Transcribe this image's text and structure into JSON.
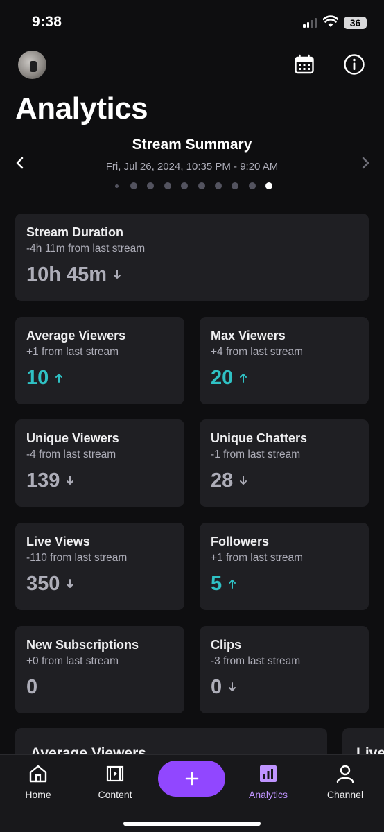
{
  "status_bar": {
    "time": "9:38",
    "battery": "36"
  },
  "header": {
    "title": "Analytics"
  },
  "summary": {
    "title": "Stream Summary",
    "date_range": "Fri, Jul 26, 2024, 10:35 PM - 9:20 AM",
    "page_count": 10,
    "active_page": 10
  },
  "cards": {
    "stream_duration": {
      "title": "Stream Duration",
      "change": "-4h 11m from last stream",
      "value": "10h 45m",
      "trend": "down"
    },
    "average_viewers": {
      "title": "Average Viewers",
      "change": "+1 from last stream",
      "value": "10",
      "trend": "up"
    },
    "max_viewers": {
      "title": "Max Viewers",
      "change": "+4 from last stream",
      "value": "20",
      "trend": "up"
    },
    "unique_viewers": {
      "title": "Unique Viewers",
      "change": "-4 from last stream",
      "value": "139",
      "trend": "down"
    },
    "unique_chatters": {
      "title": "Unique Chatters",
      "change": "-1 from last stream",
      "value": "28",
      "trend": "down"
    },
    "live_views": {
      "title": "Live Views",
      "change": "-110 from last stream",
      "value": "350",
      "trend": "down"
    },
    "followers": {
      "title": "Followers",
      "change": "+1 from last stream",
      "value": "5",
      "trend": "up"
    },
    "new_subscriptions": {
      "title": "New Subscriptions",
      "change": "+0 from last stream",
      "value": "0",
      "trend": "none"
    },
    "clips": {
      "title": "Clips",
      "change": "-3 from last stream",
      "value": "0",
      "trend": "down"
    }
  },
  "peek": {
    "left_title": "Average Viewers",
    "right_title": "Live"
  },
  "nav": {
    "home": "Home",
    "content": "Content",
    "analytics": "Analytics",
    "channel": "Channel"
  },
  "colors": {
    "accent": "#9147ff",
    "up": "#2fc1c4",
    "active_nav": "#bf94ff",
    "card_bg": "#1f1f23"
  }
}
